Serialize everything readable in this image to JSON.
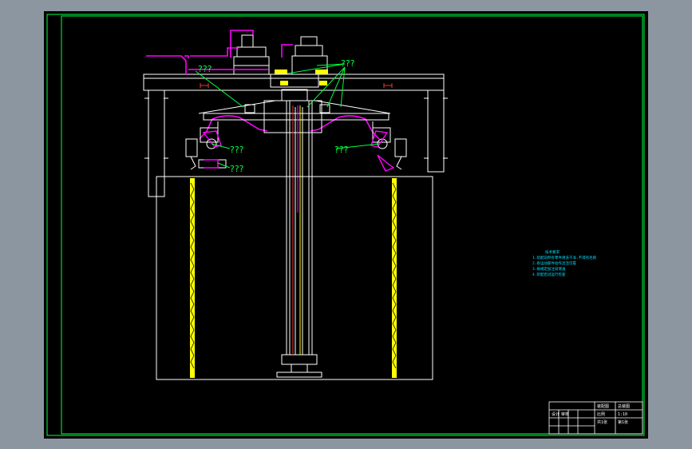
{
  "colors": {
    "background": "#8c96a0",
    "sheet": "#000000",
    "frame": "#00ff40",
    "structure": "#ffffff",
    "pipe": "#ff00ff",
    "highlight": "#ffff00",
    "notes": "#00e0ff",
    "leader": "#00ff40"
  },
  "callouts": [
    {
      "id": "top-left",
      "text": "???"
    },
    {
      "id": "top-right",
      "text": "???"
    },
    {
      "id": "mid-left",
      "text": "???"
    },
    {
      "id": "mid-right",
      "text": "???"
    },
    {
      "id": "low-left",
      "text": "???"
    }
  ],
  "notes": {
    "title": "技术要求",
    "lines": [
      "1.装配前所有零件清洗干净,不得有毛刺",
      "2.各运动部件动作灵活可靠",
      "3.按规定加注润滑油",
      "4.装配后试运行检查"
    ]
  },
  "title_block": {
    "cells": [
      "装配图",
      "总装图",
      "设计",
      "审核",
      "比例",
      "1:10",
      "共1张",
      "第1张"
    ]
  }
}
